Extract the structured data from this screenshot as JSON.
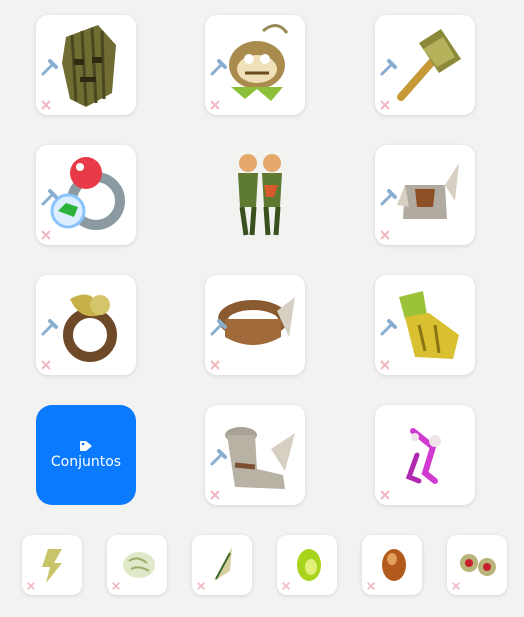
{
  "sets_button": {
    "label": "Conjuntos",
    "icon": "tag-icon"
  },
  "colors": {
    "accent": "#0a7aff",
    "background": "#f2f2f1",
    "slot": "#ffffff",
    "hammer_badge": "#8aaed0",
    "remove_x": "#f0b8c0"
  },
  "slots": [
    {
      "item": "helmet-mask-icon",
      "has_hammer": true,
      "has_remove": true
    },
    {
      "item": "monkey-amulet-icon",
      "has_hammer": true,
      "has_remove": true
    },
    {
      "item": "hammer-weapon-icon",
      "has_hammer": true,
      "has_remove": true
    },
    {
      "item": "ring-red-orb-icon",
      "has_hammer": true,
      "has_remove": true
    },
    {
      "item": "character-preview",
      "has_hammer": false,
      "has_remove": false
    },
    {
      "item": "shoulder-armor-icon",
      "has_hammer": true,
      "has_remove": true
    },
    {
      "item": "leaf-ring-icon",
      "has_hammer": true,
      "has_remove": true
    },
    {
      "item": "belt-icon",
      "has_hammer": true,
      "has_remove": true
    },
    {
      "item": "cape-icon",
      "has_hammer": true,
      "has_remove": true
    },
    {
      "item": "boots-icon",
      "has_hammer": true,
      "has_remove": true
    },
    {
      "item": "pet-icon",
      "has_hammer": false,
      "has_remove": true
    }
  ],
  "dofus_slots": [
    {
      "item": "lightning-dofus-icon",
      "has_remove": true
    },
    {
      "item": "brain-dofus-icon",
      "has_remove": true
    },
    {
      "item": "feather-dofus-icon",
      "has_remove": true
    },
    {
      "item": "green-dofus-egg-icon",
      "has_remove": true
    },
    {
      "item": "amber-dofus-egg-icon",
      "has_remove": true
    },
    {
      "item": "eyes-dofus-icon",
      "has_remove": true
    }
  ]
}
